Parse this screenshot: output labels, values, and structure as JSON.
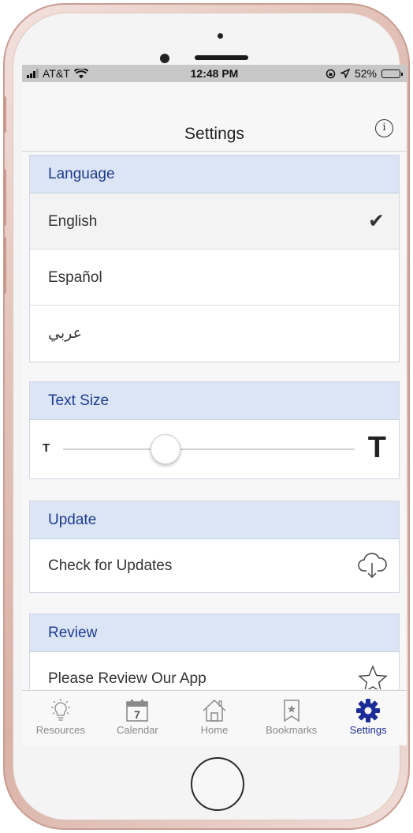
{
  "status_bar": {
    "carrier": "AT&T",
    "time": "12:48 PM",
    "battery": "52%",
    "battery_level": 0.52
  },
  "nav": {
    "title": "Settings",
    "info_icon": "info-icon"
  },
  "sections": {
    "language": {
      "header": "Language",
      "options": [
        "English",
        "Español",
        "عربي"
      ],
      "selected": "English"
    },
    "text_size": {
      "header": "Text Size",
      "small_label": "T",
      "large_label": "T",
      "slider_value": 0.35
    },
    "update": {
      "header": "Update",
      "label": "Check for Updates",
      "icon": "cloud-download-icon"
    },
    "review": {
      "header": "Review",
      "label": "Please Review Our App",
      "icon": "star-icon"
    }
  },
  "tabs": [
    {
      "label": "Resources",
      "icon": "lightbulb-icon"
    },
    {
      "label": "Calendar",
      "icon": "calendar-icon",
      "day": "7"
    },
    {
      "label": "Home",
      "icon": "home-icon"
    },
    {
      "label": "Bookmarks",
      "icon": "bookmark-icon"
    },
    {
      "label": "Settings",
      "icon": "gear-icon"
    }
  ],
  "colors": {
    "accent": "#1d2d97",
    "section_header_bg": "#dbe5f5",
    "section_header_text": "#1d3b8f",
    "phone_frame": "#e3c2b9"
  }
}
